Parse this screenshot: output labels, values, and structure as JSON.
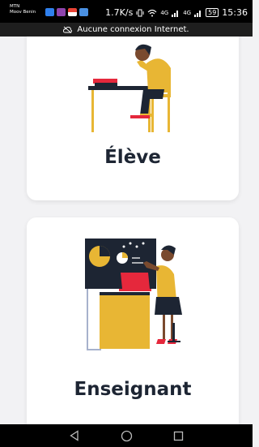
{
  "status_bar": {
    "carrier": "MTN",
    "carrier_sub": "Moov Benin",
    "speed": "1.7K/s",
    "network_1": "4G",
    "network_2": "4G",
    "battery": "59",
    "time": "15:36",
    "notification_icons": [
      "chat-icon",
      "gallery-icon",
      "gmail-icon",
      "image-icon"
    ]
  },
  "offline_banner": {
    "icon": "cloud-off-icon",
    "text": "Aucune connexion Internet."
  },
  "cards": [
    {
      "label": "Élève",
      "illustration": "student-studying-illustration"
    },
    {
      "label": "Enseignant",
      "illustration": "teacher-presenting-illustration"
    }
  ],
  "nav_bar": {
    "items": [
      "back-icon",
      "home-icon",
      "recents-icon"
    ]
  },
  "colors": {
    "accent_yellow": "#e8b634",
    "dark_navy": "#1d2533",
    "accent_red": "#e5283c",
    "card_bg": "#ffffff",
    "page_bg": "#f2f2f4"
  }
}
